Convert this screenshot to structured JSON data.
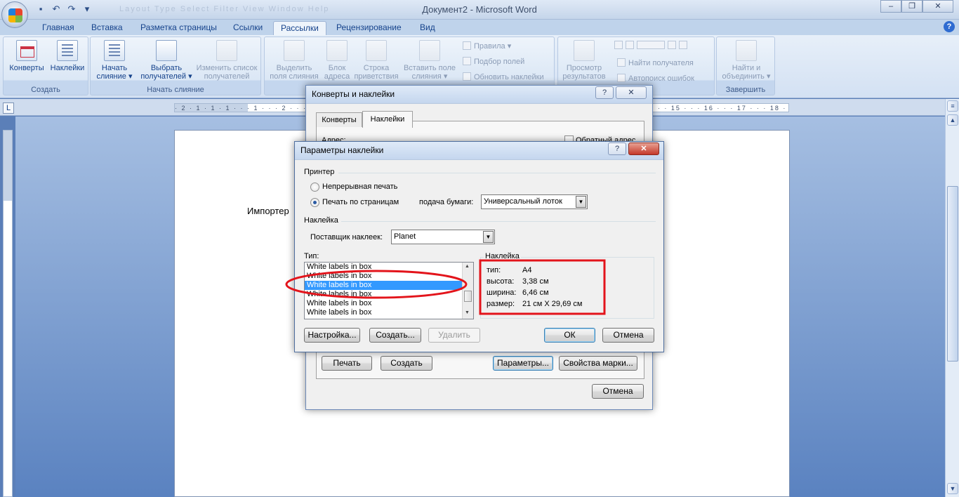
{
  "window": {
    "title": "Документ2 - Microsoft Word"
  },
  "qat": {
    "faded_items": "Layout  Type  Select  Filter  View  Window  Help"
  },
  "tabs": [
    {
      "label": "Главная"
    },
    {
      "label": "Вставка"
    },
    {
      "label": "Разметка страницы"
    },
    {
      "label": "Ссылки"
    },
    {
      "label": "Рассылки"
    },
    {
      "label": "Рецензирование"
    },
    {
      "label": "Вид"
    }
  ],
  "ribbon": {
    "groups": {
      "create": "Создать",
      "start_merge": "Начать слияние",
      "fields_partial": "атов",
      "finish": "Завершить"
    },
    "envelopes": "Конверты",
    "labels": "Наклейки",
    "start_merge_l1": "Начать",
    "start_merge_l2": "слияние ▾",
    "select_rcpt_l1": "Выбрать",
    "select_rcpt_l2": "получателей ▾",
    "edit_list_l1": "Изменить список",
    "edit_list_l2": "получателей",
    "highlight_l1": "Выделить",
    "highlight_l2": "поля слияния",
    "address_block_l1": "Блок",
    "address_block_l2": "адреса",
    "greeting_l1": "Строка",
    "greeting_l2": "приветствия",
    "insert_field_l1": "Вставить поле",
    "insert_field_l2": "слияния ▾",
    "rules": "Правила ▾",
    "match_fields": "Подбор полей",
    "update_labels": "Обновить наклейки",
    "preview_l1": "Просмотр",
    "preview_l2": "результатов",
    "find_rcpt": "Найти получателя",
    "autocheck": "Автопоиск ошибок",
    "finish_l1": "Найти и",
    "finish_l2": "объединить ▾"
  },
  "ruler": {
    "corner": "L",
    "marks": "· 2 · 1 · 1 · 1 · · · 1 · · · 2 · · · 3 · · · 4 · · · 5 · · · 6 · · · 7 · · · 8 · · · 9 · · · 10 · · · 11 · · · 12 · · · 13 · · · 14 · · · 15 · · · 16 · · · 17 · · · 18 ·"
  },
  "document": {
    "text": "Импортер"
  },
  "env_dialog": {
    "title": "Конверты и наклейки",
    "help": "?",
    "close": "✕",
    "tab_envelopes": "Конверты",
    "tab_labels": "Наклейки",
    "address_label": "Адрес:",
    "return_address": "Обратный адрес",
    "print": "Печать",
    "create": "Создать",
    "options": "Параметры...",
    "epostage": "Свойства марки...",
    "cancel": "Отмена"
  },
  "label_dialog": {
    "title": "Параметры наклейки",
    "help": "?",
    "close": "✕",
    "printer_section": "Принтер",
    "continuous": "Непрерывная печать",
    "page_printers": "Печать по страницам",
    "tray_label": "подача бумаги:",
    "tray_value": "Универсальный лоток",
    "label_section": "Наклейка",
    "vendor_label": "Поставщик наклеек:",
    "vendor_value": "Planet",
    "type_label": "Тип:",
    "type_items": [
      {
        "text": "White labels in box",
        "selected": false
      },
      {
        "text": "White labels in box",
        "selected": false
      },
      {
        "text": "White labels in box",
        "selected": true
      },
      {
        "text": "White labels in box",
        "selected": false
      },
      {
        "text": "White labels in box",
        "selected": false
      },
      {
        "text": "White labels in box",
        "selected": false
      }
    ],
    "info_section": "Наклейка",
    "info": [
      {
        "key": "тип:",
        "value": "A4"
      },
      {
        "key": "высота:",
        "value": "3,38 см"
      },
      {
        "key": "ширина:",
        "value": "6,46 см"
      },
      {
        "key": "размер:",
        "value": "21 см X 29,69 см"
      }
    ],
    "settings": "Настройка...",
    "create": "Создать...",
    "delete": "Удалить",
    "ok": "ОК",
    "cancel": "Отмена"
  },
  "colors": {
    "highlight_red": "#e3141b",
    "selection_blue": "#3399ff"
  }
}
